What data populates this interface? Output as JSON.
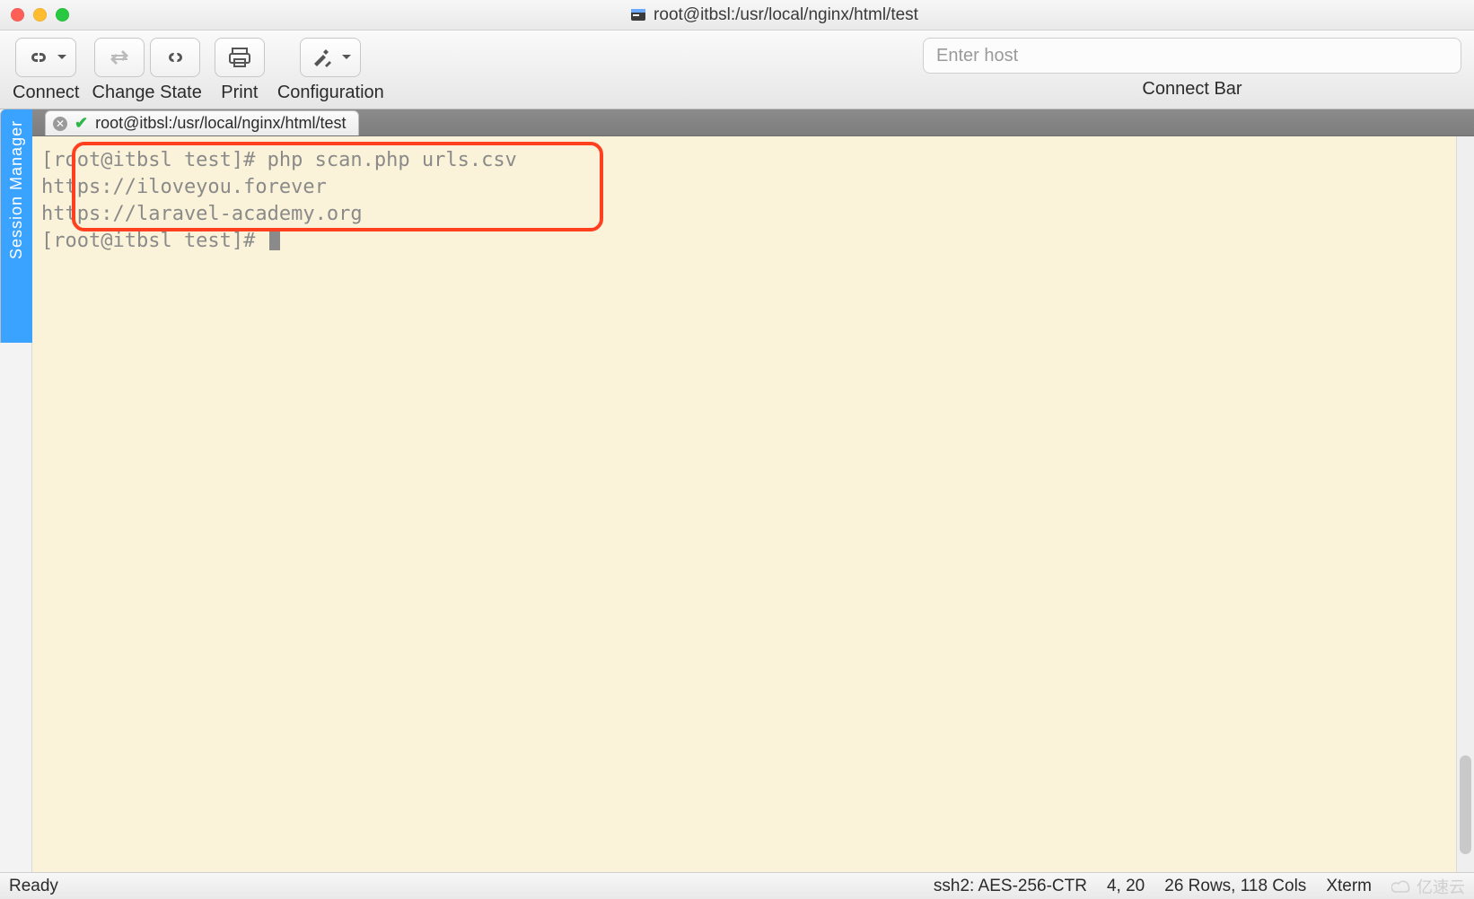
{
  "window": {
    "title": "root@itbsl:/usr/local/nginx/html/test"
  },
  "toolbar": {
    "connect_label": "Connect",
    "change_state_label": "Change State",
    "print_label": "Print",
    "configuration_label": "Configuration",
    "connect_bar_label": "Connect Bar",
    "host_placeholder": "Enter host"
  },
  "sidebar": {
    "session_manager_label": "Session Manager"
  },
  "tab": {
    "title": "root@itbsl:/usr/local/nginx/html/test"
  },
  "terminal": {
    "line1": "[root@itbsl test]# php scan.php urls.csv",
    "line2": "https://iloveyou.forever",
    "line3": "https://laravel-academy.org",
    "line4": "[root@itbsl test]# "
  },
  "status": {
    "ready": "Ready",
    "cipher": "ssh2: AES-256-CTR",
    "cursor": "4, 20",
    "size": "26 Rows, 118 Cols",
    "term": "Xterm"
  },
  "watermark": "亿速云"
}
